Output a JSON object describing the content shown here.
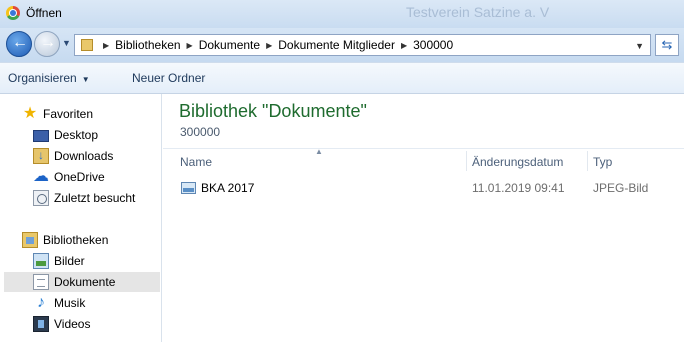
{
  "window": {
    "title": "Öffnen",
    "background_title": "Testverein Satzine a. V"
  },
  "address": {
    "crumbs": [
      "Bibliotheken",
      "Dokumente",
      "Dokumente Mitglieder",
      "300000"
    ]
  },
  "commands": {
    "organize": "Organisieren",
    "new_folder": "Neuer Ordner"
  },
  "nav": {
    "favorites": {
      "label": "Favoriten",
      "items": [
        "Desktop",
        "Downloads",
        "OneDrive",
        "Zuletzt besucht"
      ]
    },
    "libraries": {
      "label": "Bibliotheken",
      "items": [
        "Bilder",
        "Dokumente",
        "Musik",
        "Videos"
      ],
      "selected": "Dokumente"
    }
  },
  "main": {
    "title": "Bibliothek \"Dokumente\"",
    "subtitle": "300000",
    "columns": {
      "name": "Name",
      "modified": "Änderungsdatum",
      "type": "Typ"
    },
    "files": [
      {
        "name": "BKA 2017",
        "modified": "11.01.2019 09:41",
        "type": "JPEG-Bild"
      }
    ]
  },
  "colors": {
    "accent": "#1e6b2e",
    "selection": "#e5e5e5"
  },
  "icons": [
    "chrome-icon",
    "back-icon",
    "forward-icon",
    "refresh-icon",
    "star-icon",
    "desktop-icon",
    "downloads-icon",
    "onedrive-icon",
    "recent-icon",
    "library-icon",
    "pictures-icon",
    "documents-icon",
    "music-icon",
    "videos-icon",
    "image-file-icon"
  ]
}
